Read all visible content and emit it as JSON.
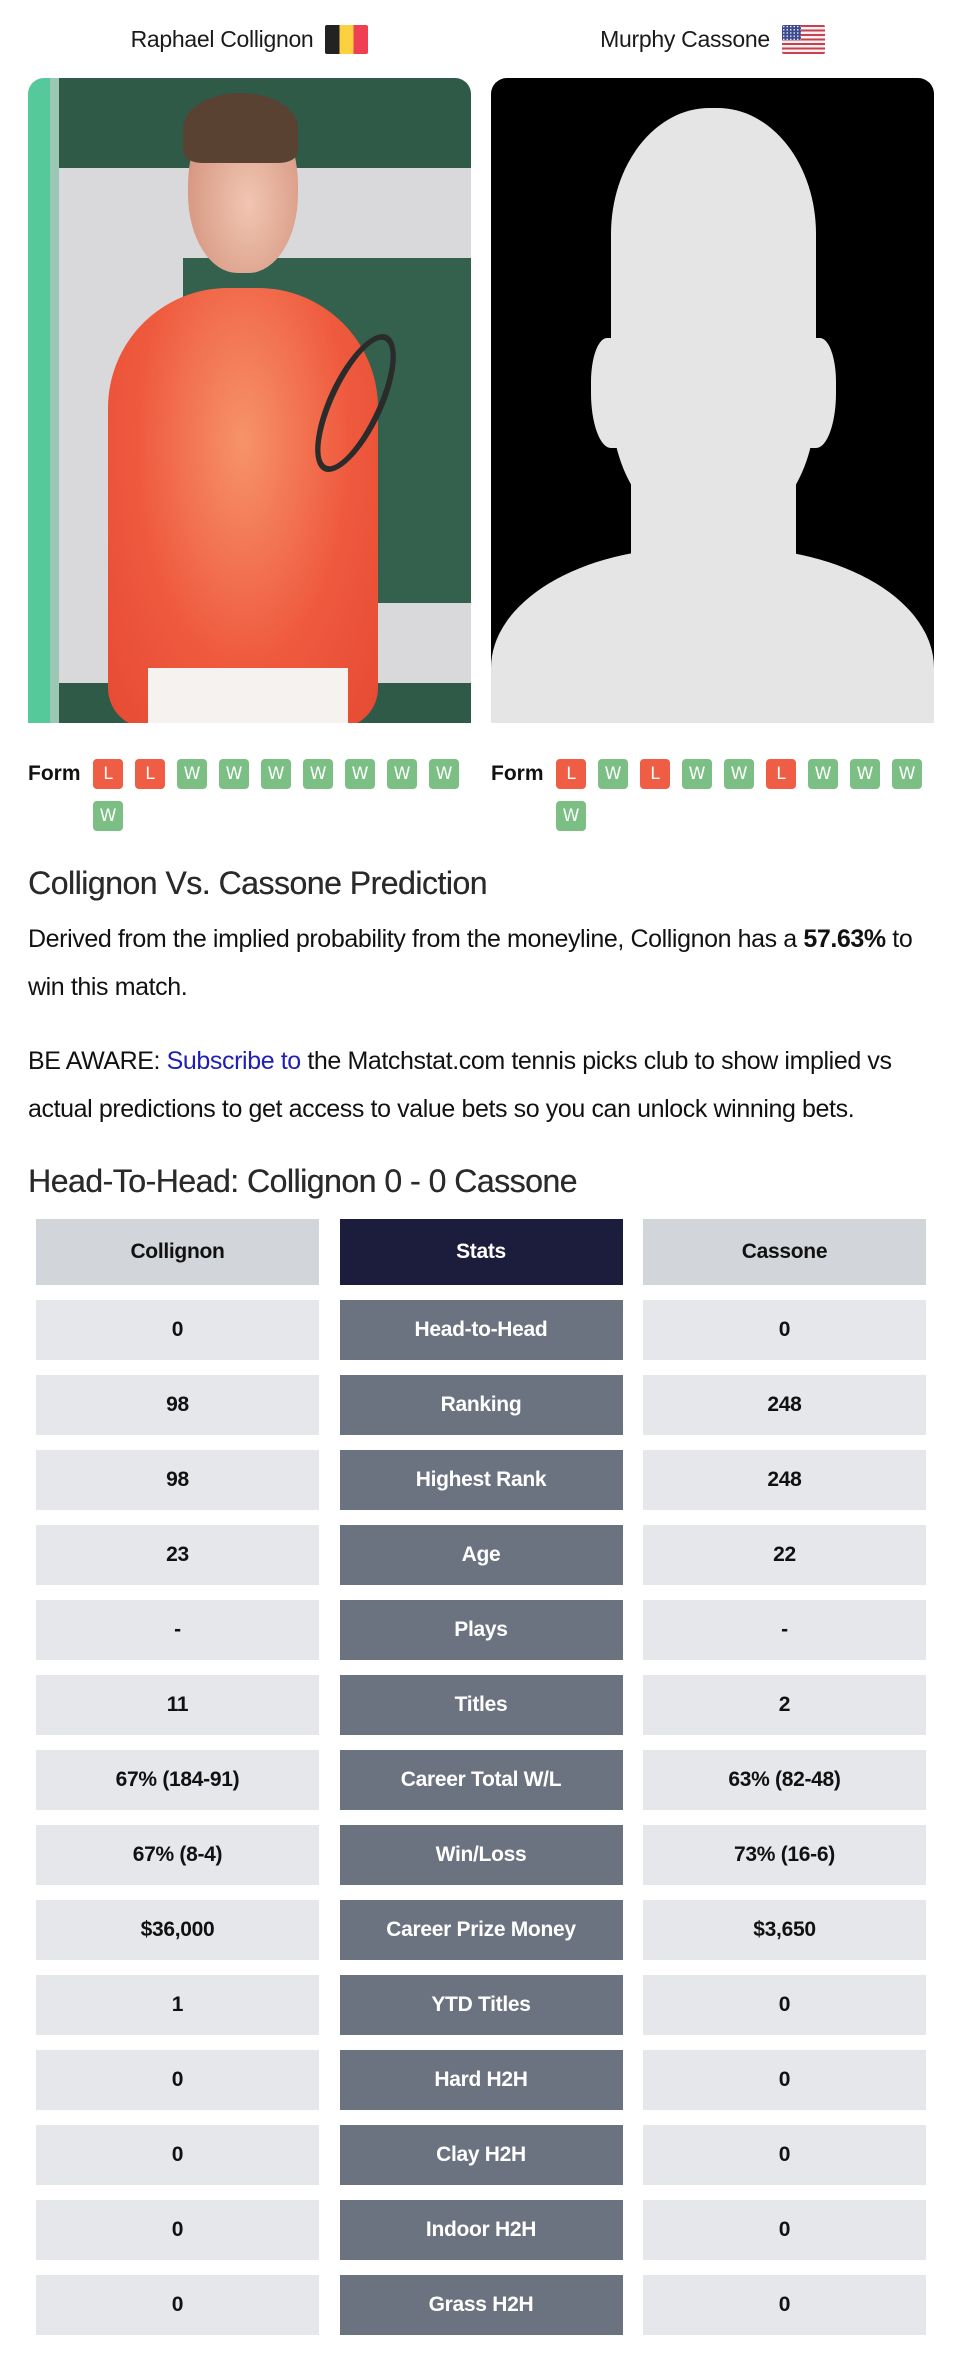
{
  "players": [
    {
      "name": "Raphael Collignon",
      "country": "Belgium",
      "flag_icon": "belgium-flag-icon",
      "photo": "player-photo",
      "form_label": "Form",
      "form": [
        "L",
        "L",
        "W",
        "W",
        "W",
        "W",
        "W",
        "W",
        "W",
        "W"
      ]
    },
    {
      "name": "Murphy Cassone",
      "country": "United States",
      "flag_icon": "usa-flag-icon",
      "photo": "placeholder-silhouette",
      "form_label": "Form",
      "form": [
        "L",
        "W",
        "L",
        "W",
        "W",
        "L",
        "W",
        "W",
        "W",
        "W"
      ]
    }
  ],
  "prediction": {
    "title": "Collignon Vs. Cassone Prediction",
    "text_before": "Derived from the implied probability from the moneyline, Collignon has a ",
    "probability": "57.63%",
    "text_after": " to win this match."
  },
  "aware": {
    "prefix": "BE AWARE: ",
    "link_text": "Subscribe to",
    "suffix": " the Matchstat.com tennis picks club to show implied vs actual predictions to get access to value bets so you can unlock winning bets."
  },
  "h2h": {
    "title": "Head-To-Head: Collignon 0 - 0 Cassone",
    "header": {
      "left": "Collignon",
      "mid": "Stats",
      "right": "Cassone"
    },
    "rows": [
      {
        "left": "0",
        "stat": "Head-to-Head",
        "right": "0"
      },
      {
        "left": "98",
        "stat": "Ranking",
        "right": "248"
      },
      {
        "left": "98",
        "stat": "Highest Rank",
        "right": "248"
      },
      {
        "left": "23",
        "stat": "Age",
        "right": "22"
      },
      {
        "left": "-",
        "stat": "Plays",
        "right": "-"
      },
      {
        "left": "11",
        "stat": "Titles",
        "right": "2"
      },
      {
        "left": "67% (184-91)",
        "stat": "Career Total W/L",
        "right": "63% (82-48)"
      },
      {
        "left": "67% (8-4)",
        "stat": "Win/Loss",
        "right": "73% (16-6)"
      },
      {
        "left": "$36,000",
        "stat": "Career Prize Money",
        "right": "$3,650"
      },
      {
        "left": "1",
        "stat": "YTD Titles",
        "right": "0"
      },
      {
        "left": "0",
        "stat": "Hard H2H",
        "right": "0"
      },
      {
        "left": "0",
        "stat": "Clay H2H",
        "right": "0"
      },
      {
        "left": "0",
        "stat": "Indoor H2H",
        "right": "0"
      },
      {
        "left": "0",
        "stat": "Grass H2H",
        "right": "0"
      }
    ]
  },
  "colors": {
    "loss_badge": "#ef5d45",
    "win_badge": "#7bbf84",
    "stats_header": "#1c1c3c",
    "stat_label_bg": "#6b7280",
    "value_cell_bg": "#e5e7ea",
    "link": "#1f1fb4"
  }
}
